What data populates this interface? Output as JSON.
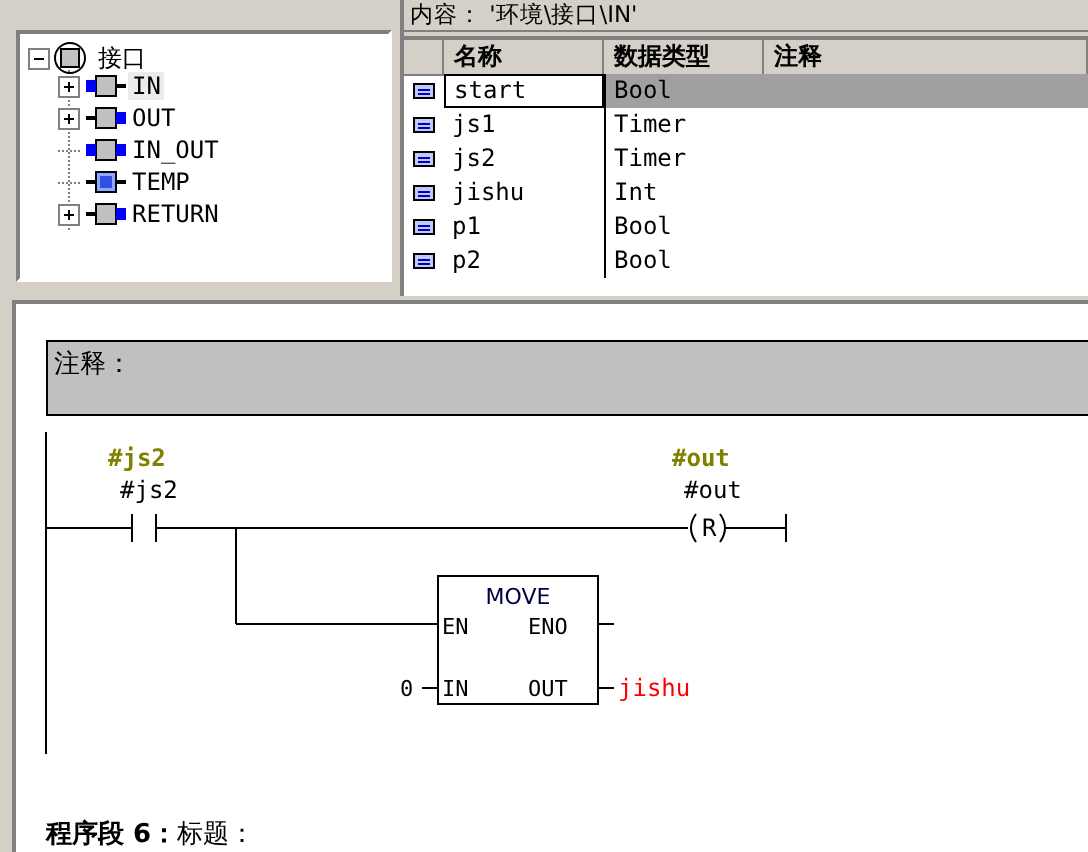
{
  "tree": {
    "root": {
      "label": "接口",
      "expanded": true,
      "children": [
        {
          "label": "IN",
          "kind": "input",
          "collapsed": true,
          "selected": true
        },
        {
          "label": "OUT",
          "kind": "output",
          "collapsed": true,
          "selected": false
        },
        {
          "label": "IN_OUT",
          "kind": "inout",
          "collapsed": false,
          "selected": false
        },
        {
          "label": "TEMP",
          "kind": "temp",
          "collapsed": false,
          "selected": false
        },
        {
          "label": "RETURN",
          "kind": "output",
          "collapsed": true,
          "selected": false
        }
      ]
    }
  },
  "content_path": "内容： '环境\\接口\\IN'",
  "table": {
    "columns": [
      "名称",
      "数据类型",
      "注释"
    ],
    "rows": [
      {
        "name": "start",
        "type": "Bool",
        "selected": true
      },
      {
        "name": "js1",
        "type": "Timer",
        "selected": false
      },
      {
        "name": "js2",
        "type": "Timer",
        "selected": false
      },
      {
        "name": "jishu",
        "type": "Int",
        "selected": false
      },
      {
        "name": "p1",
        "type": "Bool",
        "selected": false
      },
      {
        "name": "p2",
        "type": "Bool",
        "selected": false
      }
    ]
  },
  "network": {
    "comment_label": "注释：",
    "contact": {
      "symbol": "#js2",
      "operand": "#js2"
    },
    "coil": {
      "symbol": "#out",
      "operand": "#out",
      "letter": "R"
    },
    "box": {
      "title": "MOVE",
      "pins": [
        "EN",
        "ENO",
        "IN",
        "OUT"
      ],
      "in_value": "0",
      "out_value": "jishu"
    }
  },
  "next_network": "**程序段 6：**标题："
}
